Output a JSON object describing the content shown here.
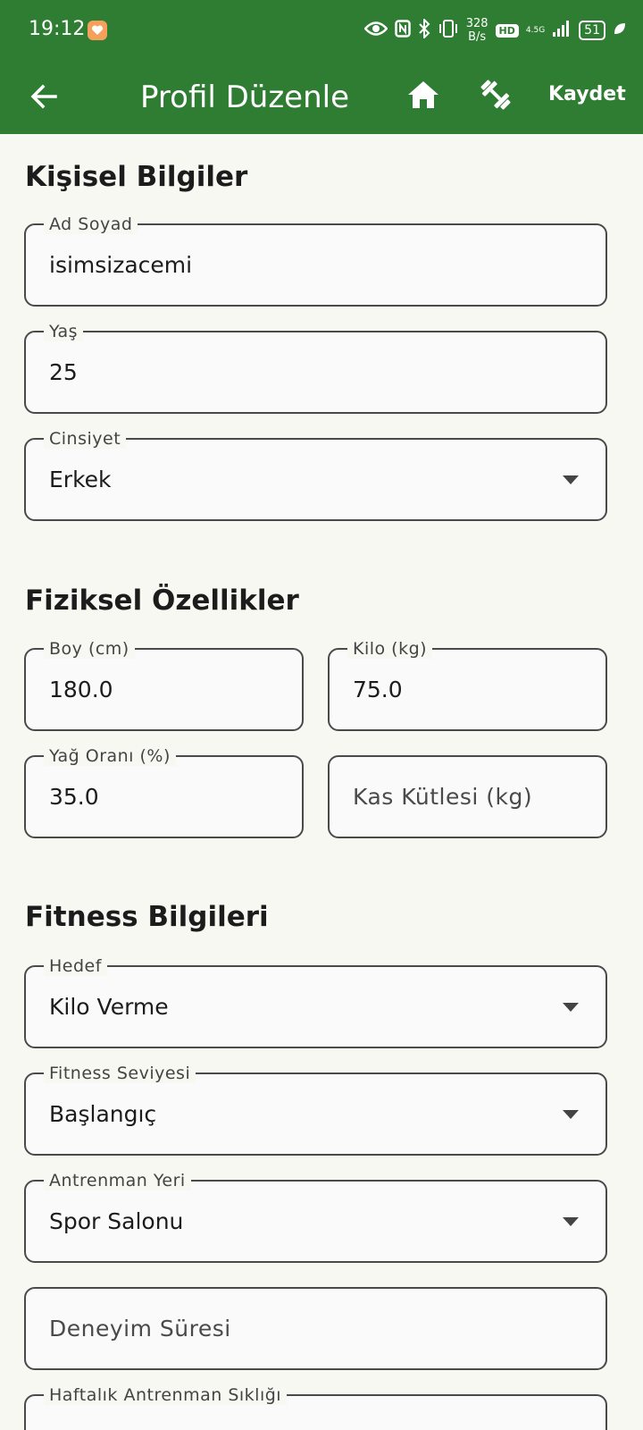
{
  "status_bar": {
    "time": "19:12",
    "net_speed_value": "328",
    "net_speed_unit": "B/s",
    "hd_label": "HD",
    "network_type": "4.5G",
    "battery": "51"
  },
  "app_bar": {
    "title": "Profil Düzenle",
    "save_label": "Kaydet",
    "color": "#2E7D32"
  },
  "sections": {
    "personal": "Kişisel Bilgiler",
    "physical": "Fiziksel Özellikler",
    "fitness": "Fitness Bilgileri"
  },
  "fields": {
    "name": {
      "label": "Ad Soyad",
      "value": "isimsizacemi"
    },
    "age": {
      "label": "Yaş",
      "value": "25"
    },
    "gender": {
      "label": "Cinsiyet",
      "value": "Erkek"
    },
    "height": {
      "label": "Boy (cm)",
      "value": "180.0"
    },
    "weight": {
      "label": "Kilo (kg)",
      "value": "75.0"
    },
    "fat": {
      "label": "Yağ Oranı (%)",
      "value": "35.0"
    },
    "muscle": {
      "placeholder": "Kas Kütlesi (kg)"
    },
    "goal": {
      "label": "Hedef",
      "value": "Kilo Verme"
    },
    "level": {
      "label": "Fitness Seviyesi",
      "value": "Başlangıç"
    },
    "location": {
      "label": "Antrenman Yeri",
      "value": "Spor Salonu"
    },
    "experience": {
      "placeholder": "Deneyim Süresi"
    },
    "frequency": {
      "label": "Haftalık Antrenman Sıklığı"
    }
  }
}
